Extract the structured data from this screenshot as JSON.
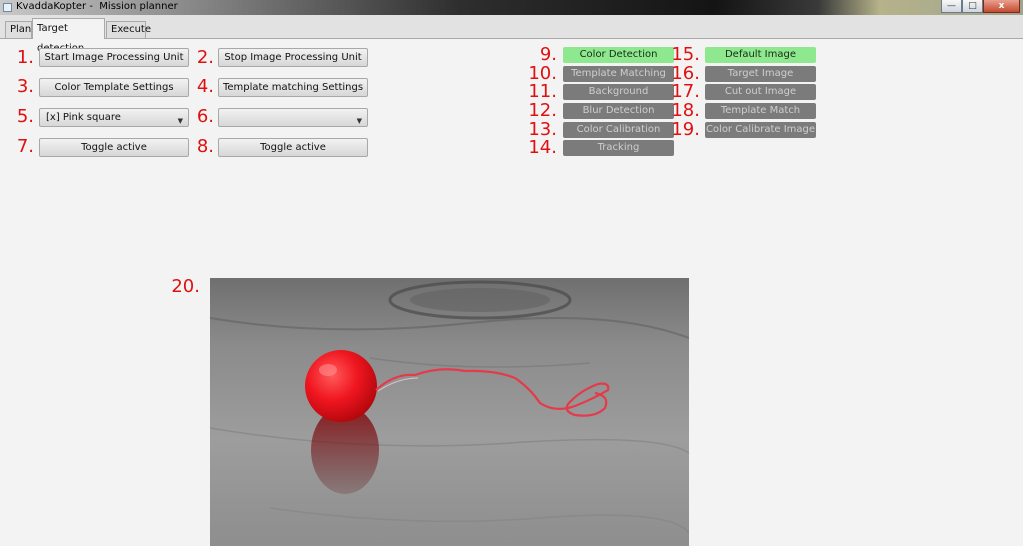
{
  "window": {
    "title": "KvaddaKopter -  Mission planner",
    "controls": {
      "minimize": "—",
      "maximize": "□",
      "close": "x"
    }
  },
  "tabs": [
    {
      "label": "Plan"
    },
    {
      "label": "Target detection"
    },
    {
      "label": "Execute"
    }
  ],
  "markers": [
    "1.",
    "2.",
    "3.",
    "4.",
    "5.",
    "6.",
    "7.",
    "8.",
    "9.",
    "10.",
    "11.",
    "12.",
    "13.",
    "14.",
    "15.",
    "16.",
    "17.",
    "18.",
    "19.",
    "20."
  ],
  "controls": {
    "start_unit": "Start Image Processing Unit",
    "stop_unit": "Stop Image Processing Unit",
    "color_template_settings": "Color Template Settings",
    "template_matching_settings": "Template matching Settings",
    "select_left_value": "[x] Pink square",
    "select_right_value": "",
    "toggle_left": "Toggle active",
    "toggle_right": "Toggle active"
  },
  "processing": [
    {
      "label": "Color Detection",
      "active": true
    },
    {
      "label": "Template Matching",
      "active": false
    },
    {
      "label": "Background Subtraction",
      "active": false
    },
    {
      "label": "Blur Detection",
      "active": false
    },
    {
      "label": "Color Calibration",
      "active": false
    },
    {
      "label": "Tracking",
      "active": false
    }
  ],
  "views": [
    {
      "label": "Default Image",
      "active": true
    },
    {
      "label": "Target Image",
      "active": false
    },
    {
      "label": "Cut out Image",
      "active": false
    },
    {
      "label": "Template Match Image",
      "active": false
    },
    {
      "label": "Color Calibrate Image",
      "active": false
    }
  ],
  "colors": {
    "active_pill": "#8ee88e",
    "inactive_pill": "#7b7b7b",
    "marker": "#e01010",
    "balloon": "#f01620"
  }
}
